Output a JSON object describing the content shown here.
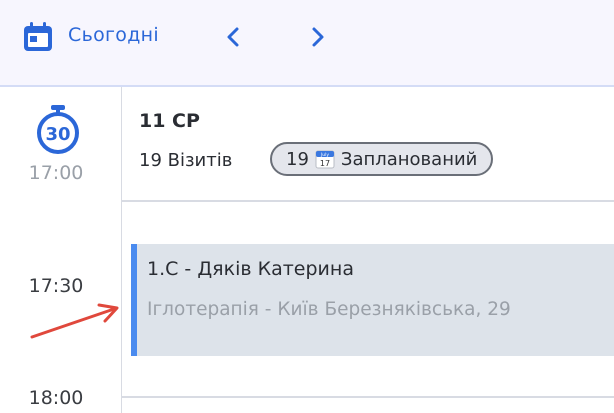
{
  "toolbar": {
    "today_label": "Сьогодні",
    "calendar_icon": "calendar-icon",
    "prev_icon": "chevron-left-icon",
    "next_icon": "chevron-right-icon",
    "accent_color": "#2b67d8"
  },
  "time_column": {
    "timer_icon": "timer-30-icon",
    "timer_value": "30",
    "slots": [
      "17:00",
      "17:30",
      "18:00"
    ]
  },
  "day_header": {
    "title": "11 СР",
    "visits_label": "19 Візитів",
    "chip": {
      "count": "19",
      "icon": "calendar-icon",
      "icon_month": "July",
      "icon_day": "17",
      "label": "Запланований"
    }
  },
  "event": {
    "title": "1.С - Дяків Катерина",
    "subtitle": "Іглотерапія - Київ  Березняківська, 29",
    "accent_color": "#4a8bef",
    "background": "#dde3ea"
  },
  "annotation": {
    "arrow_icon": "red-arrow-icon",
    "color": "#e0483c"
  }
}
